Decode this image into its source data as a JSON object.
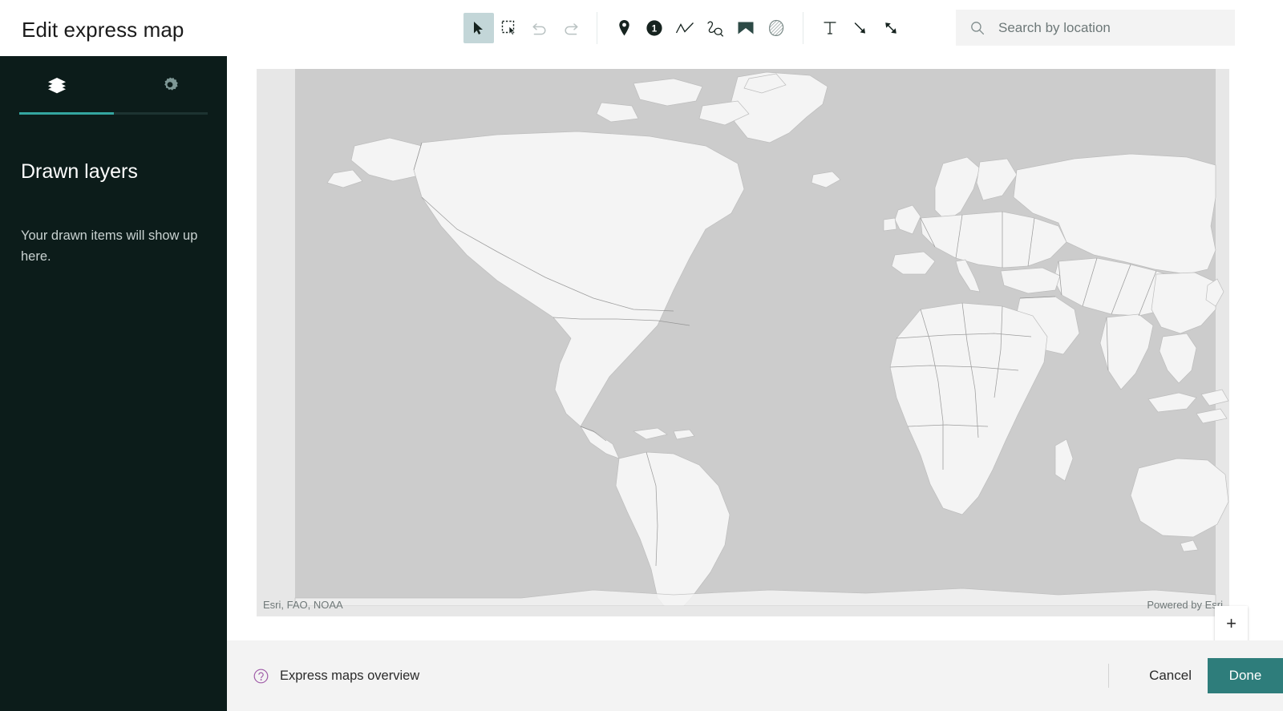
{
  "header": {
    "title": "Edit express map",
    "tools": [
      {
        "name": "select-tool",
        "icon": "cursor-icon",
        "label": "Select",
        "active": true
      },
      {
        "name": "marquee-select-tool",
        "icon": "marquee-select-icon",
        "label": "Select area",
        "active": false
      },
      {
        "name": "undo-tool",
        "icon": "undo-icon",
        "label": "Undo",
        "active": false
      },
      {
        "name": "redo-tool",
        "icon": "redo-icon",
        "label": "Redo",
        "active": false
      },
      {
        "name": "point-tool",
        "icon": "map-pin-icon",
        "label": "Point",
        "active": false
      },
      {
        "name": "numbered-point-tool",
        "icon": "numbered-pin-icon",
        "label": "Numbered point",
        "active": false
      },
      {
        "name": "line-tool",
        "icon": "polyline-icon",
        "label": "Line",
        "active": false
      },
      {
        "name": "freehand-line-tool",
        "icon": "freehand-line-icon",
        "label": "Freehand line",
        "active": false
      },
      {
        "name": "polygon-tool",
        "icon": "polygon-icon",
        "label": "Area",
        "active": false
      },
      {
        "name": "freehand-area-tool",
        "icon": "freehand-area-icon",
        "label": "Freehand area",
        "active": false
      },
      {
        "name": "text-tool",
        "icon": "text-icon",
        "label": "Text",
        "active": false
      },
      {
        "name": "arrow-tool",
        "icon": "arrow-icon",
        "label": "Arrow",
        "active": false
      },
      {
        "name": "double-arrow-tool",
        "icon": "double-arrow-icon",
        "label": "Double arrow",
        "active": false
      }
    ],
    "numbered_pin_value": "1"
  },
  "search": {
    "icon": "search-icon",
    "placeholder": "Search by location",
    "value": ""
  },
  "sidebar": {
    "tabs": [
      {
        "name": "tab-layers",
        "icon": "layers-icon",
        "active": true
      },
      {
        "name": "tab-settings",
        "icon": "gear-icon",
        "active": false
      }
    ],
    "panel_title": "Drawn layers",
    "empty_message": "Your drawn items will show up here."
  },
  "map": {
    "attribution": "Esri, FAO, NOAA",
    "powered_by": "Powered by Esri",
    "zoom_in_label": "+",
    "zoom_out_label": "—"
  },
  "footer": {
    "overview_icon": "question-circle-icon",
    "overview_label": "Express maps overview",
    "cancel_label": "Cancel",
    "done_label": "Done"
  },
  "colors": {
    "sidebar_bg": "#0c1c1a",
    "accent_teal": "#34a6a0",
    "primary_button": "#2e7d7b",
    "active_tool_bg": "#c3d6d8",
    "help_icon": "#a05ca8",
    "map_ocean": "#cccccc",
    "map_land": "#f4f4f4",
    "map_frame": "#e7e7e7"
  }
}
